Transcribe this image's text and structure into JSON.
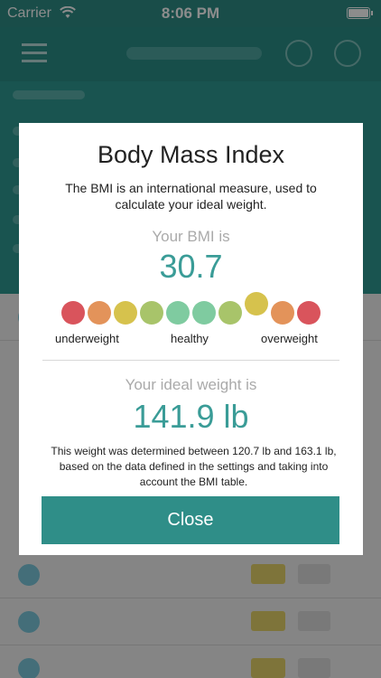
{
  "status_bar": {
    "carrier": "Carrier",
    "time": "8:06 PM",
    "icons": [
      "wifi-icon",
      "battery-icon"
    ]
  },
  "modal": {
    "title": "Body Mass Index",
    "description": "The BMI is an international measure, used to calculate your ideal weight.",
    "bmi_label": "Your BMI is",
    "bmi_value": "30.7",
    "scale": {
      "colors": [
        "#d9545c",
        "#e3935a",
        "#d6c24d",
        "#a8c46a",
        "#7fcba0",
        "#7fcba0",
        "#a8c46a",
        "#d6c24d",
        "#e3935a",
        "#d9545c"
      ],
      "active_index": 7,
      "labels": {
        "left": "underweight",
        "middle": "healthy",
        "right": "overweight"
      }
    },
    "ideal_label": "Your ideal weight is",
    "ideal_value": "141.9 lb",
    "ideal_note": "This weight was determined between 120.7 lb and 163.1 lb, based on the data defined in the settings and taking into account the BMI table.",
    "close_label": "Close"
  },
  "colors": {
    "accent": "#2f8e88",
    "value_text": "#3a9c97"
  }
}
